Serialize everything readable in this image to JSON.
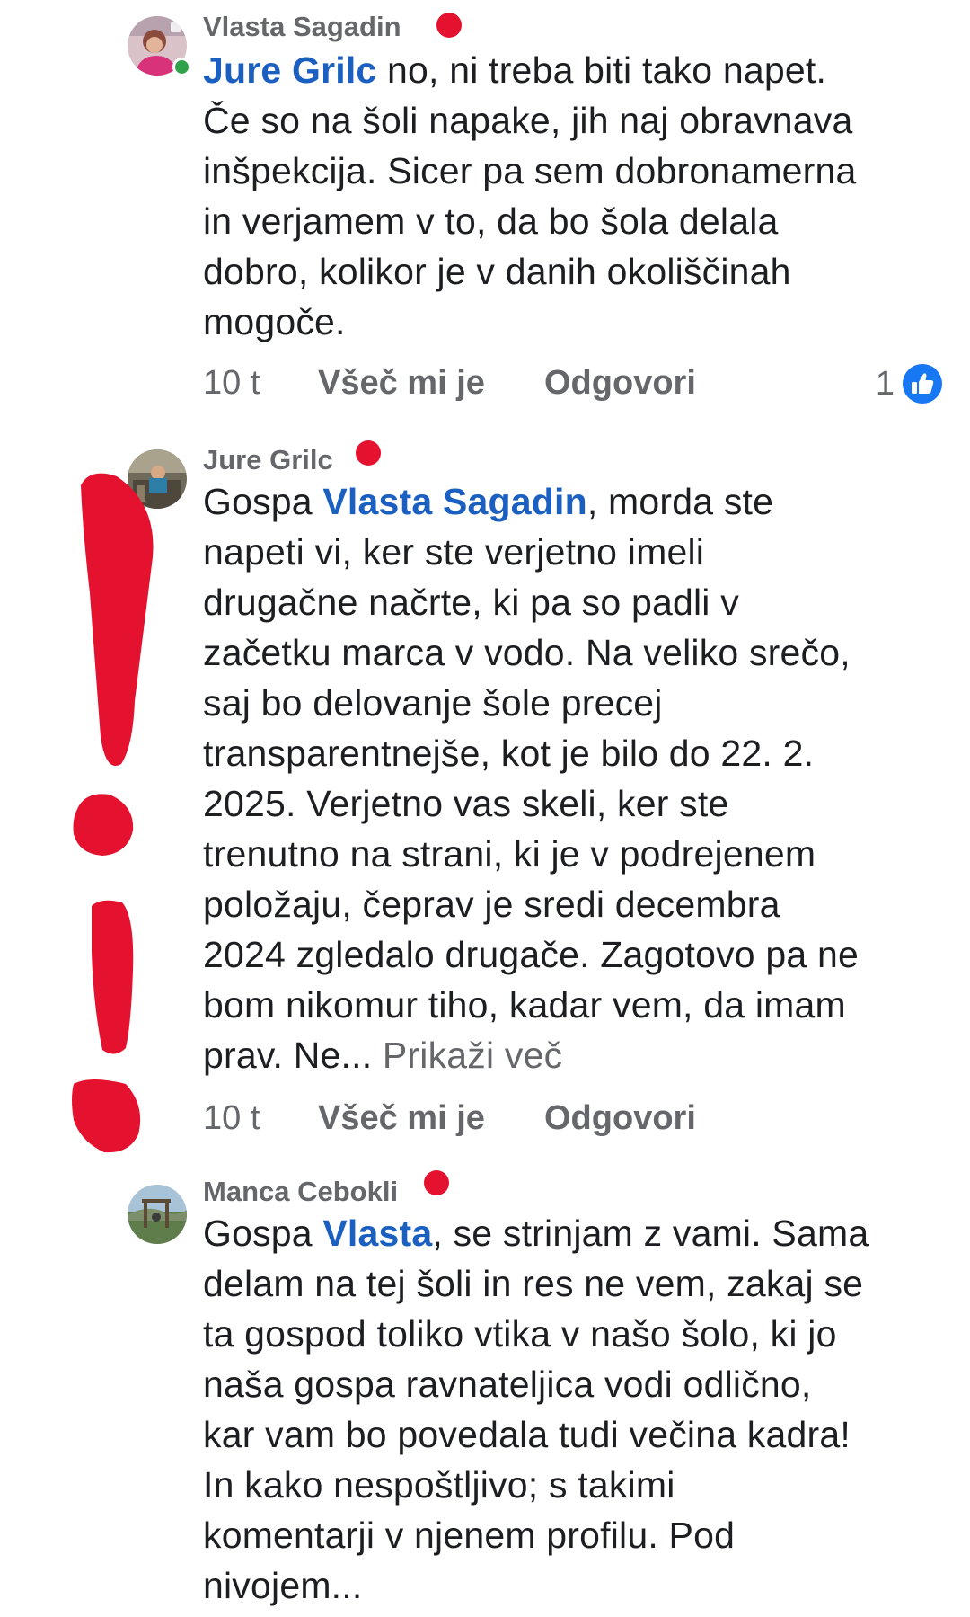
{
  "comments": [
    {
      "author": "Vlasta Sagadin",
      "mention": "Jure Grilc",
      "lines": [
        " no, ni treba biti tako napet.",
        "Če so na šoli napake, jih naj obravnava",
        "inšpekcija. Sicer pa sem dobronamerna",
        "in verjamem v to, da bo šola delala",
        "dobro, kolikor je v danih okoliščinah",
        "mogoče."
      ],
      "time": "10 t",
      "like_label": "Všeč mi je",
      "reply_label": "Odgovori",
      "reaction_count": "1",
      "reaction_icon": "like-icon",
      "online": true
    },
    {
      "author": "Jure Grilc",
      "prefix": "Gospa ",
      "mention": "Vlasta Sagadin",
      "first_line_rest": ", morda ste",
      "lines": [
        "napeti vi, ker ste verjetno imeli",
        "drugačne načrte, ki pa so padli v",
        "začetku marca v vodo. Na veliko srečo,",
        "saj bo delovanje šole precej",
        "transparentnejše, kot je bilo do 22. 2.",
        "2025. Verjetno vas skeli, ker ste",
        "trenutno na strani, ki je v podrejenem",
        "položaju, čeprav je sredi decembra",
        "2024 zgledalo drugače. Zagotovo pa ne",
        "bom nikomur tiho, kadar vem, da imam"
      ],
      "last_line": "prav. Ne... ",
      "see_more": "Prikaži več",
      "time": "10 t",
      "like_label": "Všeč mi je",
      "reply_label": "Odgovori"
    },
    {
      "author": "Manca Cebokli",
      "prefix": "Gospa ",
      "mention": "Vlasta",
      "first_line_rest": ", se strinjam z vami. Sama",
      "lines": [
        "delam na tej šoli in res ne vem, zakaj se",
        "ta gospod toliko vtika v našo šolo, ki jo",
        "naša gospa ravnateljica vodi odlično,",
        "kar vam bo povedala tudi večina kadra!",
        "In kako nespoštljivo; s takimi",
        "komentarji v njenem profilu. Pod",
        "nivojem..."
      ]
    }
  ],
  "colors": {
    "mention": "#1b5fc1",
    "secondary_text": "#65676b",
    "annotation_red": "#e4112f",
    "like_blue": "#1877f2",
    "online_green": "#31a24c"
  }
}
